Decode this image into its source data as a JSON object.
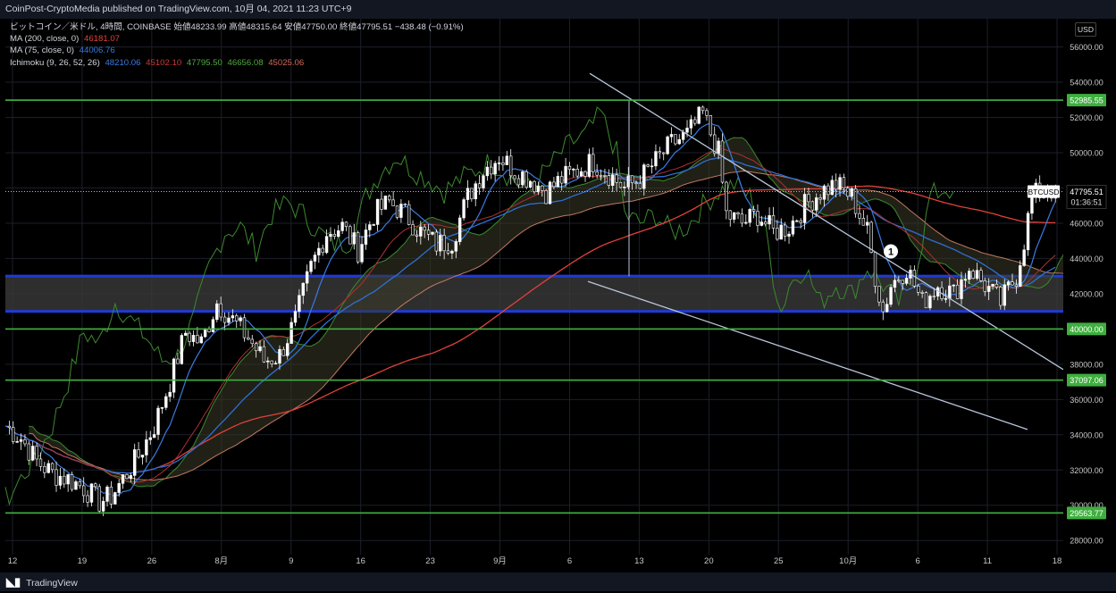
{
  "header": {
    "publisher": "CoinPost-CryptoMedia published on TradingView.com, 10月 04, 2021 11:23 UTC+9"
  },
  "legend": {
    "symbol_line": "ビットコイン／米ドル, 4時間, COINBASE  始値48233.99  高値48315.64  安値47750.00  終値47795.51  −438.48 (−0.91%)",
    "ma200_label": "MA (200, close, 0)",
    "ma200_value": "46181.07",
    "ma75_label": "MA (75, close, 0)",
    "ma75_value": "44006.76",
    "ichimoku_label": "Ichimoku (9, 26, 52, 26)",
    "ichimoku_values": [
      "48210.06",
      "45102.10",
      "47795.50",
      "46656.08",
      "45025.06"
    ]
  },
  "price_axis": {
    "currency": "USD",
    "ticks": [
      "56000.00",
      "54000.00",
      "52000.00",
      "50000.00",
      "48000.00",
      "46000.00",
      "44000.00",
      "42000.00",
      "40000.00",
      "38000.00",
      "36000.00",
      "34000.00",
      "32000.00",
      "30000.00",
      "28000.00"
    ],
    "tick_values": [
      56000,
      54000,
      52000,
      50000,
      48000,
      46000,
      44000,
      42000,
      40000,
      38000,
      36000,
      34000,
      32000,
      30000,
      28000
    ],
    "current_label": "BTCUSD",
    "current_price": "47795.51",
    "countdown": "01:36:51"
  },
  "time_axis": {
    "labels": [
      "12",
      "19",
      "26",
      "8月",
      "9",
      "16",
      "23",
      "9月",
      "6",
      "13",
      "20",
      "25",
      "10月",
      "6",
      "11",
      "18"
    ]
  },
  "footer": {
    "brand": "TradingView"
  },
  "annotation": {
    "marker": "1"
  },
  "colors": {
    "candle": "#ffffff",
    "ma200": "#e0423a",
    "ma75": "#2e6fd6",
    "tenkan": "#3a7be0",
    "kijun": "#b03030",
    "chikou": "#3c8a2e",
    "spanA": "#3c8a2e",
    "spanB": "#c07a60",
    "support_line": "#3fae3f",
    "zone_line": "#1e3bd6",
    "trend_line": "#b8c6dc"
  },
  "chart_data": {
    "type": "line",
    "title": "ビットコイン／米ドル, 4時間, COINBASE",
    "ylim": [
      27200,
      57600
    ],
    "x_labels": [
      "12",
      "19",
      "26",
      "8月",
      "9",
      "16",
      "23",
      "9月",
      "6",
      "13",
      "20",
      "25",
      "10月",
      "6",
      "11",
      "18"
    ],
    "horizontal_levels": [
      {
        "label": "52985.55",
        "value": 52985.55
      },
      {
        "label": "40000.00",
        "value": 40000.0
      },
      {
        "label": "37097.06",
        "value": 37097.06
      },
      {
        "label": "29563.77",
        "value": 29563.77
      }
    ],
    "zone": {
      "top": 43000,
      "bottom": 41000
    },
    "last_price": 47795.51,
    "price_path": [
      [
        0,
        34500
      ],
      [
        4,
        33800
      ],
      [
        8,
        32500
      ],
      [
        12,
        31800
      ],
      [
        16,
        31500
      ],
      [
        20,
        31000
      ],
      [
        24,
        30200
      ],
      [
        27,
        30500
      ],
      [
        30,
        31500
      ],
      [
        34,
        32800
      ],
      [
        38,
        34500
      ],
      [
        42,
        37000
      ],
      [
        46,
        39800
      ],
      [
        50,
        39200
      ],
      [
        54,
        41500
      ],
      [
        58,
        40500
      ],
      [
        62,
        39500
      ],
      [
        66,
        38200
      ],
      [
        70,
        38500
      ],
      [
        74,
        40500
      ],
      [
        78,
        43500
      ],
      [
        82,
        45500
      ],
      [
        86,
        45800
      ],
      [
        90,
        44500
      ],
      [
        94,
        46500
      ],
      [
        98,
        47200
      ],
      [
        102,
        46500
      ],
      [
        106,
        45500
      ],
      [
        110,
        44800
      ],
      [
        114,
        45000
      ],
      [
        118,
        47500
      ],
      [
        122,
        49000
      ],
      [
        126,
        49800
      ],
      [
        130,
        49000
      ],
      [
        134,
        48500
      ],
      [
        138,
        47800
      ],
      [
        142,
        48500
      ],
      [
        146,
        49000
      ],
      [
        150,
        49500
      ],
      [
        154,
        48800
      ],
      [
        158,
        48000
      ],
      [
        162,
        48500
      ],
      [
        166,
        49500
      ],
      [
        170,
        50500
      ],
      [
        174,
        51000
      ],
      [
        178,
        52200
      ],
      [
        182,
        50000
      ],
      [
        184,
        46500
      ],
      [
        188,
        46000
      ],
      [
        192,
        46500
      ],
      [
        196,
        45500
      ],
      [
        200,
        45800
      ],
      [
        204,
        47000
      ],
      [
        208,
        47800
      ],
      [
        212,
        48200
      ],
      [
        216,
        47500
      ],
      [
        220,
        45500
      ],
      [
        222,
        43000
      ],
      [
        224,
        41000
      ],
      [
        226,
        42500
      ],
      [
        230,
        43500
      ],
      [
        234,
        41500
      ],
      [
        238,
        42500
      ],
      [
        242,
        42000
      ],
      [
        246,
        43500
      ],
      [
        250,
        42500
      ],
      [
        254,
        41500
      ],
      [
        258,
        43000
      ],
      [
        260,
        45000
      ],
      [
        262,
        47500
      ],
      [
        266,
        48000
      ],
      [
        268,
        47795.51
      ]
    ],
    "series": [
      {
        "name": "MA (200, close, 0)",
        "last": 46181.07
      },
      {
        "name": "MA (75, close, 0)",
        "last": 44006.76
      }
    ]
  }
}
